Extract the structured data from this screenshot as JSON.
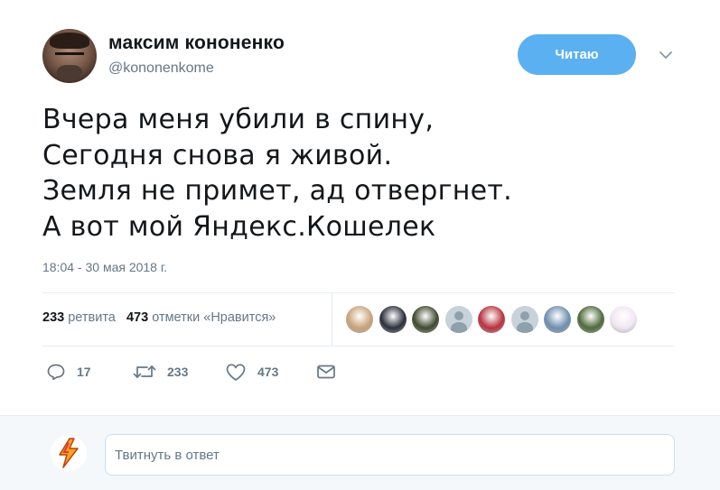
{
  "author": {
    "name": "максим кононенко",
    "handle": "@kononenkome",
    "avatar_icon": "user-photo"
  },
  "follow_button": {
    "label": "Читаю"
  },
  "tweet": {
    "lines": [
      "Вчера меня убили в спину,",
      "Сегодня снова я живой.",
      "Земля не примет, ад отвергнет.",
      "А вот мой Яндекс.Кошелек"
    ],
    "timestamp": "18:04 - 30 мая 2018 г."
  },
  "stats": {
    "retweets_count": "233",
    "retweets_label": "ретвита",
    "likes_count": "473",
    "likes_label": "отметки «Нравится»"
  },
  "likers": [
    {
      "kind": "photo",
      "color": "#c9a27a"
    },
    {
      "kind": "photo",
      "color": "#2b2f3a"
    },
    {
      "kind": "photo",
      "color": "#3f4a2e"
    },
    {
      "kind": "default"
    },
    {
      "kind": "photo",
      "color": "#b8323e"
    },
    {
      "kind": "default"
    },
    {
      "kind": "photo",
      "color": "#6e8fb0"
    },
    {
      "kind": "photo",
      "color": "#4e6b3c"
    },
    {
      "kind": "photo",
      "color": "#f0e6f2"
    }
  ],
  "actions": {
    "reply_count": "17",
    "retweet_count": "233",
    "like_count": "473"
  },
  "reply_box": {
    "placeholder": "Твитнуть в ответ"
  },
  "colors": {
    "accent": "#5ab0f0",
    "muted": "#657786",
    "divider": "#e6ecf0"
  }
}
